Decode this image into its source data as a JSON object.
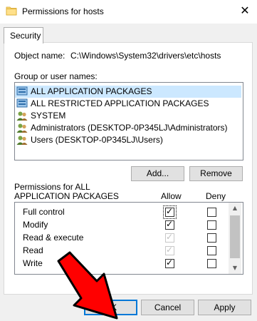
{
  "window": {
    "title": "Permissions for hosts",
    "close_glyph": "✕"
  },
  "tabs": [
    {
      "label": "Security"
    }
  ],
  "object": {
    "label": "Object name:",
    "value": "C:\\Windows\\System32\\drivers\\etc\\hosts"
  },
  "groups": {
    "label": "Group or user names:",
    "items": [
      {
        "label": "ALL APPLICATION PACKAGES",
        "icon": "packages-icon",
        "selected": true
      },
      {
        "label": "ALL RESTRICTED APPLICATION PACKAGES",
        "icon": "packages-icon",
        "selected": false
      },
      {
        "label": "SYSTEM",
        "icon": "users-icon",
        "selected": false
      },
      {
        "label": "Administrators (DESKTOP-0P345LJ\\Administrators)",
        "icon": "users-icon",
        "selected": false
      },
      {
        "label": "Users (DESKTOP-0P345LJ\\Users)",
        "icon": "users-icon",
        "selected": false
      }
    ]
  },
  "buttons": {
    "add": "Add...",
    "remove": "Remove",
    "ok": "OK",
    "cancel": "Cancel",
    "apply": "Apply"
  },
  "permissions": {
    "label_line1": "Permissions for ALL",
    "label_line2": "APPLICATION PACKAGES",
    "allow_header": "Allow",
    "deny_header": "Deny",
    "rows": [
      {
        "name": "Full control",
        "allow": true,
        "allow_disabled": false,
        "deny": false
      },
      {
        "name": "Modify",
        "allow": true,
        "allow_disabled": false,
        "deny": false
      },
      {
        "name": "Read & execute",
        "allow": true,
        "allow_disabled": true,
        "deny": false
      },
      {
        "name": "Read",
        "allow": true,
        "allow_disabled": true,
        "deny": false
      },
      {
        "name": "Write",
        "allow": true,
        "allow_disabled": false,
        "deny": false
      }
    ]
  },
  "colors": {
    "selection": "#cce8ff",
    "focus_border": "#0078d7",
    "annotation_arrow": "#ff0000"
  }
}
